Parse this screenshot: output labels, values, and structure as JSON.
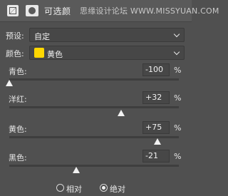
{
  "header": {
    "title": "可选颜",
    "watermark": "思缘设计论坛 WWW.MISSYUAN.COM",
    "adjustment_icon": "adjustment-layer-icon",
    "mask_icon": "layer-mask-icon"
  },
  "preset": {
    "label": "预设:",
    "value": "自定"
  },
  "colors": {
    "label": "颜色:",
    "value": "黄色",
    "swatch": "#ffd700"
  },
  "sliders": [
    {
      "label": "青色:",
      "value": "-100",
      "unit": "%",
      "level": -100
    },
    {
      "label": "洋红:",
      "value": "+32",
      "unit": "%",
      "level": 32
    },
    {
      "label": "黄色:",
      "value": "+75",
      "unit": "%",
      "level": 75
    },
    {
      "label": "黑色:",
      "value": "-21",
      "unit": "%",
      "level": -21
    }
  ],
  "method": {
    "relative_label": "相对",
    "absolute_label": "绝对",
    "selected": "absolute"
  }
}
